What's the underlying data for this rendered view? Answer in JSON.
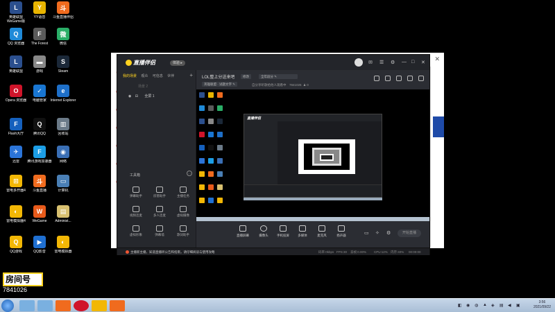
{
  "desktop": {
    "icons": [
      {
        "label": "英雄联盟\nWeGame版",
        "color": "#2b4f8e",
        "glyph": "L"
      },
      {
        "label": "YY语音",
        "color": "#e8b400",
        "glyph": "Y"
      },
      {
        "label": "斗鱼直播伴侣",
        "color": "#f06b1e",
        "glyph": "斗"
      },
      {
        "label": "QQ 浏览器",
        "color": "#1f8ad8",
        "glyph": "Q"
      },
      {
        "label": "The Forest",
        "color": "#5a5a5a",
        "glyph": "F"
      },
      {
        "label": "微信",
        "color": "#2aae67",
        "glyph": "微"
      },
      {
        "label": "英雄联盟",
        "color": "#2b4f8e",
        "glyph": "L"
      },
      {
        "label": "游戏",
        "color": "#888888",
        "glyph": "▬"
      },
      {
        "label": "Steam",
        "color": "#1b2838",
        "glyph": "S"
      },
      {
        "label": "Opera 浏览器",
        "color": "#d0142a",
        "glyph": "O"
      },
      {
        "label": "电脑管家",
        "color": "#1976d2",
        "glyph": "✓"
      },
      {
        "label": "Internet Explorer",
        "color": "#1e6fc8",
        "glyph": "e"
      },
      {
        "label": "Flash大厅",
        "color": "#1560bd",
        "glyph": "F"
      },
      {
        "label": "腾讯QQ",
        "color": "#111111",
        "glyph": "Q"
      },
      {
        "label": "回收站",
        "color": "#6b7a88",
        "glyph": "▥"
      },
      {
        "label": "迅雷",
        "color": "#2b74d8",
        "glyph": "✈"
      },
      {
        "label": "腾讯游戏加速器",
        "color": "#1c9ee6",
        "glyph": "F"
      },
      {
        "label": "网络",
        "color": "#3a6fb5",
        "glyph": "◉"
      },
      {
        "label": "雷电多开器4",
        "color": "#f2b705",
        "glyph": "⊞"
      },
      {
        "label": "斗鱼直播",
        "color": "#f06b1e",
        "glyph": "斗"
      },
      {
        "label": "计算机",
        "color": "#4a7fb5",
        "glyph": "▭"
      },
      {
        "label": "雷电模拟器4",
        "color": "#f2b705",
        "glyph": "◐"
      },
      {
        "label": "WeGame",
        "color": "#e85a1a",
        "glyph": "W"
      },
      {
        "label": "Administ...",
        "color": "#d8c070",
        "glyph": "▤"
      },
      {
        "label": "QQ游戏",
        "color": "#f2b705",
        "glyph": "Q"
      },
      {
        "label": "QQ影音",
        "color": "#1f6fd1",
        "glyph": "▶"
      },
      {
        "label": "雷电模拟器",
        "color": "#f2b705",
        "glyph": "◐"
      }
    ]
  },
  "overlay": {
    "badge_text": "房间号",
    "room_id": "7841026"
  },
  "app": {
    "title": "直播伴侣",
    "vip_label": "体验 ▸",
    "tabs": [
      "我的场景",
      "观众",
      "可信息",
      "伙伴"
    ],
    "scenes": [
      {
        "name": "场景 2"
      },
      {
        "name": "全屏 1"
      }
    ],
    "tools_title": "工具箱",
    "tools": [
      {
        "label": "弹幕助手"
      },
      {
        "label": "房管助手"
      },
      {
        "label": "主播任务"
      },
      {
        "label": "视频连麦"
      },
      {
        "label": "多人连麦"
      },
      {
        "label": "虚拟摄像"
      },
      {
        "label": "虚拟形象"
      },
      {
        "label": "弹幕墙"
      },
      {
        "label": "歌词助手"
      }
    ],
    "room": {
      "title": "LOL整上分送来吧",
      "edit_label": "修改",
      "category": "全年段分",
      "game_label": "英雄联盟 · 试题文字",
      "notice": "自分享听歌给他人观看中",
      "room_id": "7841026",
      "fans": "0"
    },
    "bottom_tools": [
      {
        "label": "直播屏幕"
      },
      {
        "label": "摄像头"
      },
      {
        "label": "手机投屏"
      },
      {
        "label": "多媒体"
      },
      {
        "label": "麦克风"
      },
      {
        "label": "扬声器"
      }
    ],
    "start_label": "开始直播",
    "status": {
      "notice": "主播新主播，知道直播听公告和指南，请仔细阅读与使用攻略",
      "items": [
        "码率:0kbps",
        "FPS:30",
        "丢帧:0.00%",
        "CPU:12%",
        "内存:40%",
        "00:00:00"
      ]
    }
  },
  "taskbar": {
    "time": "3:56",
    "date": "2021/09/22"
  }
}
